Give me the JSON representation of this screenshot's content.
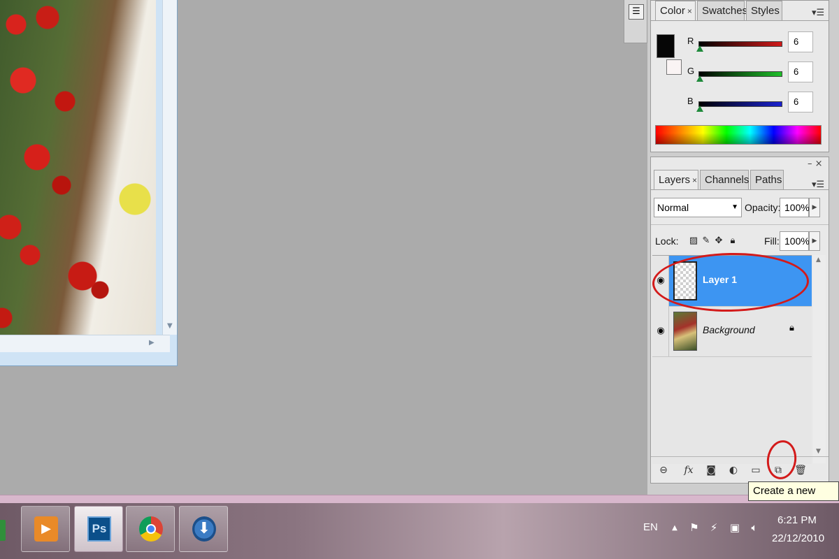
{
  "color_panel": {
    "tabs": [
      "Color",
      "Swatches",
      "Styles"
    ],
    "close_glyph": "×",
    "channels": [
      {
        "label": "R",
        "value": "6",
        "color": "#d11a1a"
      },
      {
        "label": "G",
        "value": "6",
        "color": "#1fbf2a"
      },
      {
        "label": "B",
        "value": "6",
        "color": "#1a22cf"
      }
    ],
    "foreground_color": "#060606",
    "background_color": "#faf4f4"
  },
  "layers_panel": {
    "tabs": [
      "Layers",
      "Channels",
      "Paths"
    ],
    "close_glyph": "×",
    "blend_mode": "Normal",
    "opacity_label": "Opacity:",
    "opacity_value": "100%",
    "lock_label": "Lock:",
    "fill_label": "Fill:",
    "fill_value": "100%",
    "layers": [
      {
        "name": "Layer 1",
        "selected": true
      },
      {
        "name": "Background",
        "selected": false
      }
    ]
  },
  "tooltip": "Create a new layer",
  "taskbar": {
    "ps_label": "Ps",
    "language": "EN",
    "time": "6:21 PM",
    "date": "22/12/2010"
  },
  "accent_color": "#3d95f2",
  "annotation_color": "#d31a1a"
}
